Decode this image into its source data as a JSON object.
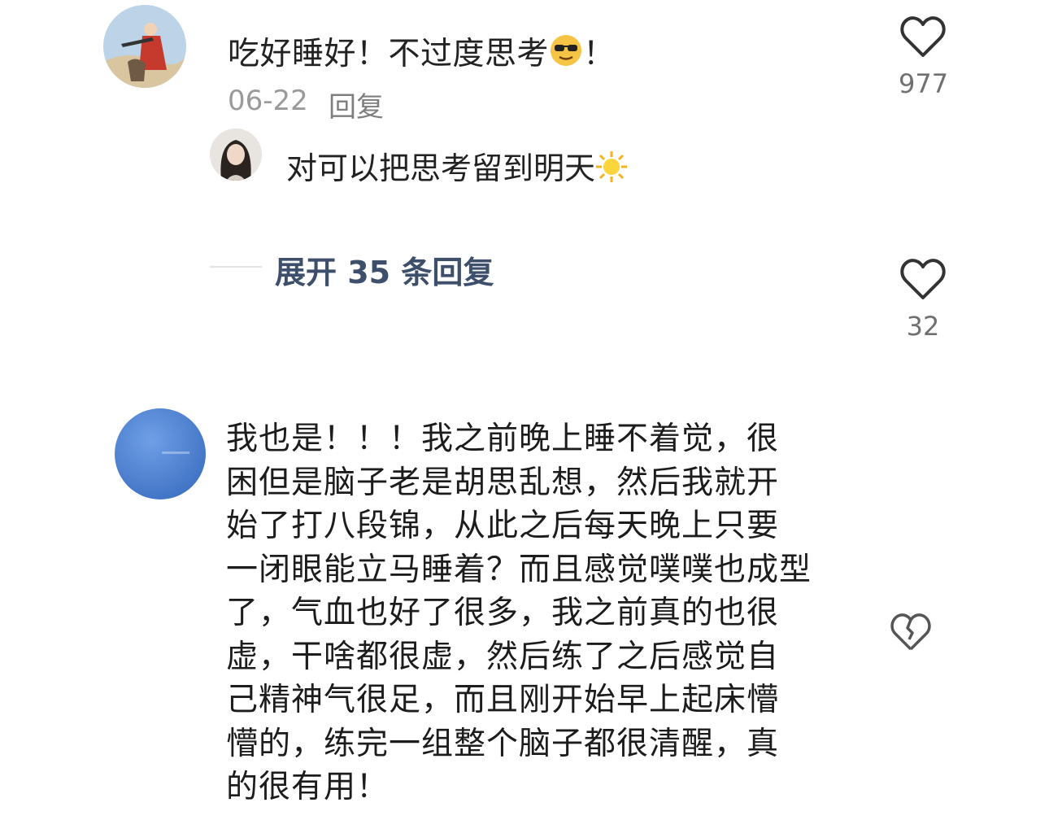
{
  "comment1": {
    "text_before_emoji": "吃好睡好！不过度思考",
    "emoji": "sunglasses-emoji",
    "text_after_emoji": "！",
    "date": "06-22",
    "reply_label": "回复",
    "like_count": "977"
  },
  "reply1": {
    "text": "对可以把思考留到明天",
    "emoji": "sun-emoji"
  },
  "expand": {
    "label": "展开 35 条回复",
    "like_count": "32"
  },
  "comment2": {
    "text": "我也是！！！我之前晚上睡不着觉，很\n困但是脑子老是胡思乱想，然后我就开\n始了打八段锦，从此之后每天晚上只要\n一闭眼能立马睡着？而且感觉噗噗也成型\n了，气血也好了很多，我之前真的也很\n虚，干啥都很虚，然后练了之后感觉自\n己精神气很足，而且刚开始早上起床懵\n懵的，练完一组整个脑子都很清醒，真\n的很有用！"
  },
  "colors": {
    "text": "#222222",
    "meta": "#9a9a9a",
    "link": "#3d4f6b",
    "avatar_blue": "#4a82d6"
  }
}
